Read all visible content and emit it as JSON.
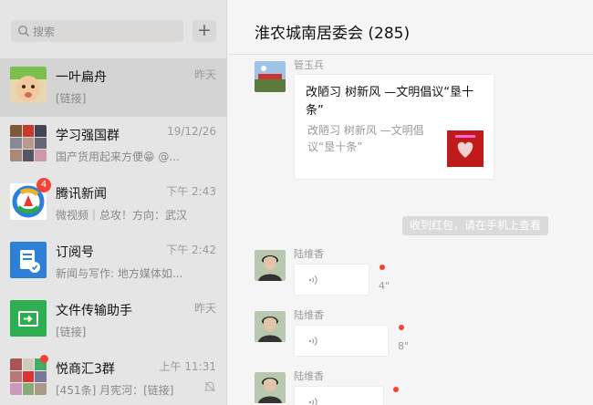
{
  "search": {
    "placeholder": "搜索",
    "add_label": "+"
  },
  "chats": [
    {
      "name": "一叶扁舟",
      "time": "昨天",
      "preview": "[链接]"
    },
    {
      "name": "学习强国群",
      "time": "19/12/26",
      "preview": "国产货用起来方便😁 @..."
    },
    {
      "name": "腾讯新闻",
      "time": "下午 2:43",
      "preview": "微视频｜总攻！方向：武汉",
      "badge": "4"
    },
    {
      "name": "订阅号",
      "time": "下午 2:42",
      "preview": "新闻与写作: 地方媒体如..."
    },
    {
      "name": "文件传输助手",
      "time": "昨天",
      "preview": "[链接]"
    },
    {
      "name": "悦商汇3群",
      "time": "上午 11:31",
      "preview": "[451条] 月宪河：[链接]"
    }
  ],
  "conversation": {
    "title": "淮农城南居委会 (285)",
    "card": {
      "sender": "管玉兵",
      "title": "改陋习  树新风 —文明倡议“垦十条”",
      "description": "改陋习  树新风 —文明倡议“垦十条”"
    },
    "system_message": "收到红包，请在手机上查看",
    "voice_messages": [
      {
        "sender": "陆维香",
        "duration": "4\""
      },
      {
        "sender": "陆维香",
        "duration": "8\""
      },
      {
        "sender": "陆维香",
        "duration": ""
      }
    ]
  },
  "colors": {
    "unread": "#f44336",
    "sidebar_bg": "#e6e5e5",
    "main_bg": "#f5f5f5"
  },
  "icons": [
    "search-icon",
    "plus-icon",
    "voice-icon",
    "mute-icon"
  ]
}
